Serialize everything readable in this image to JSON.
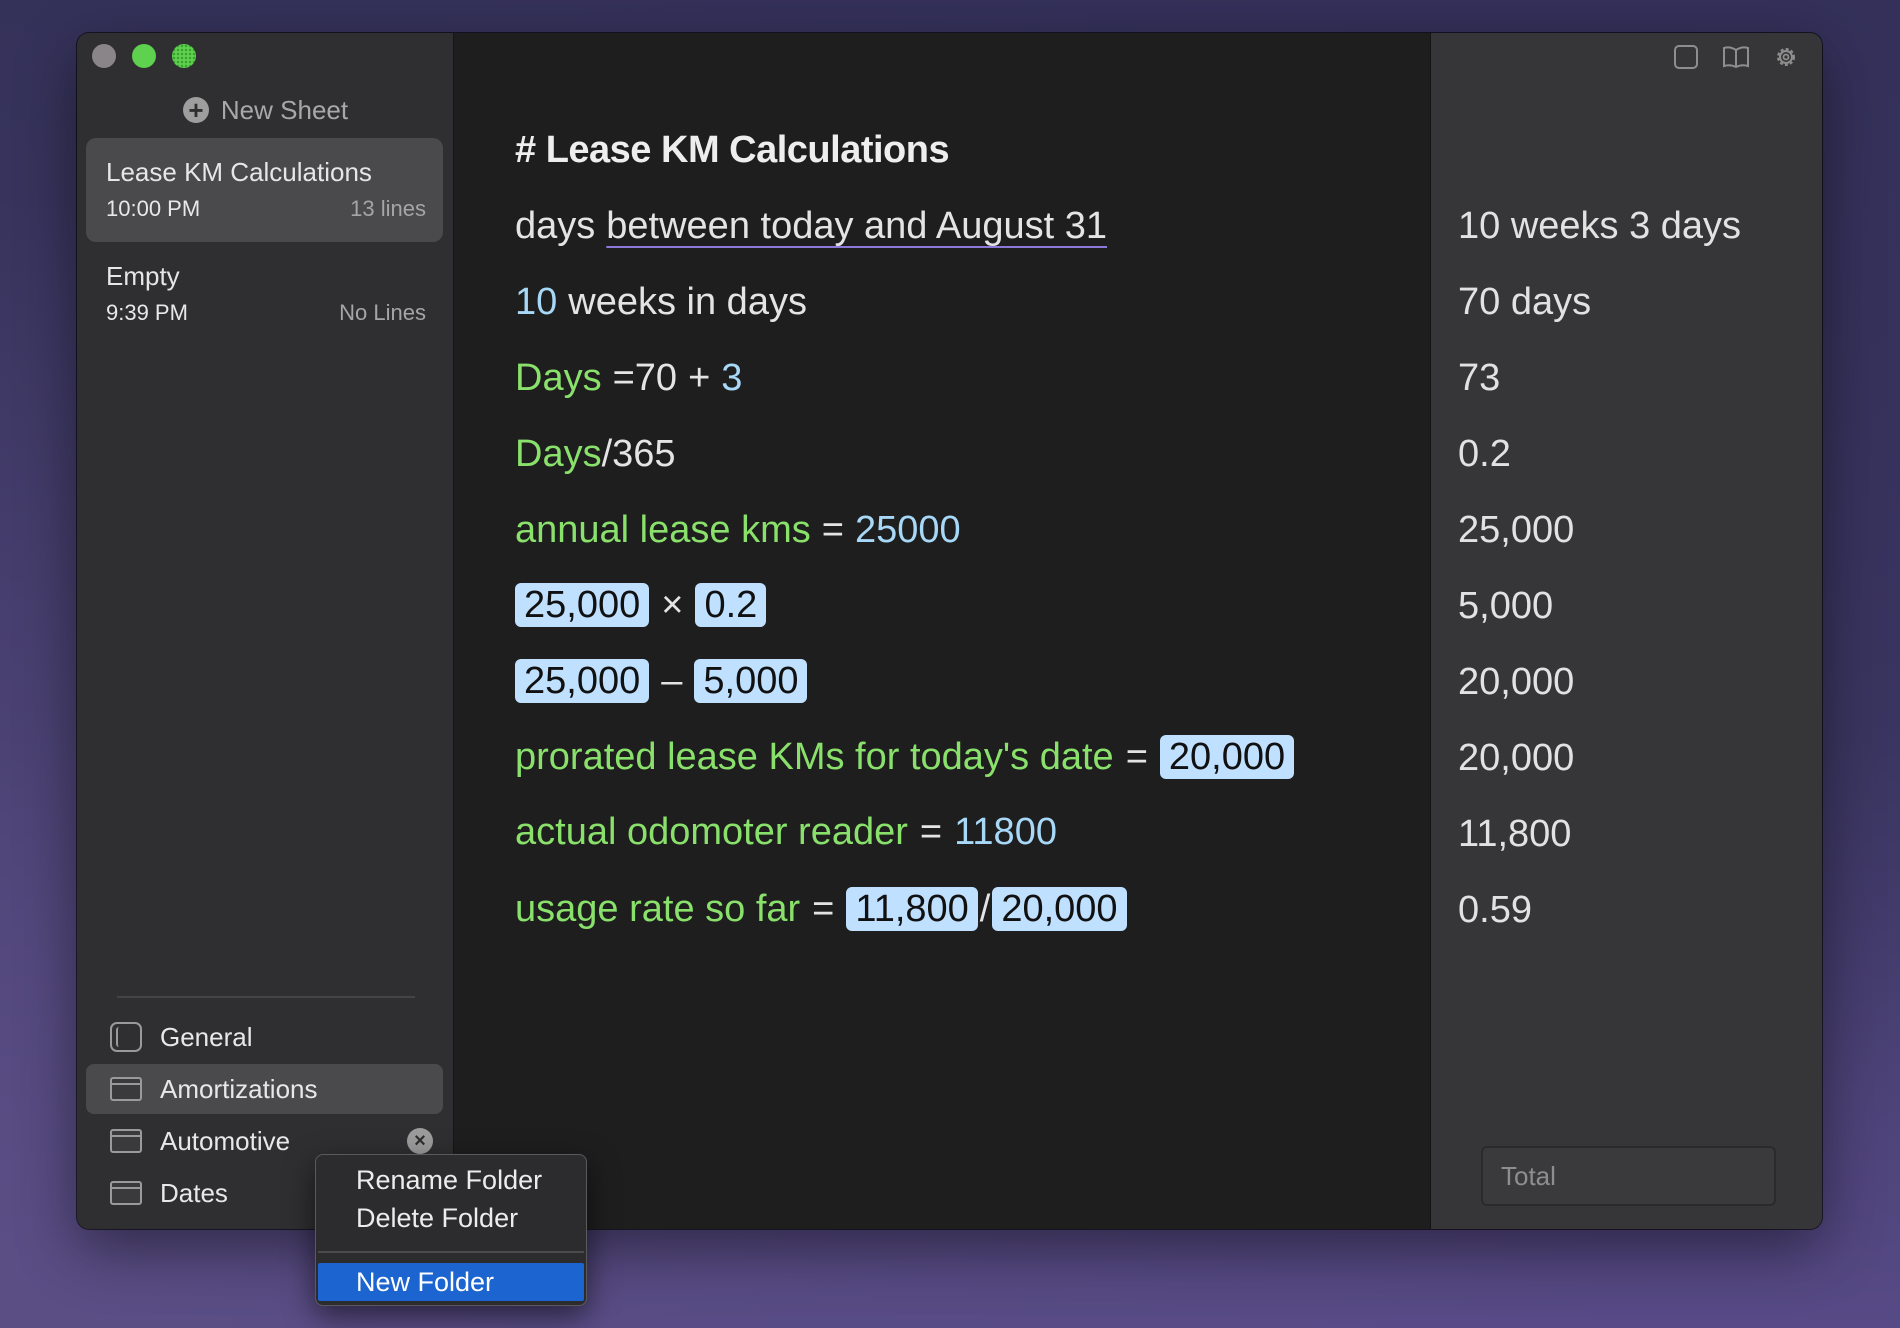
{
  "sidebar": {
    "new_sheet_label": "New Sheet",
    "sheets": [
      {
        "title": "Lease KM Calculations",
        "time": "10:00 PM",
        "lines": "13 lines"
      },
      {
        "title": "Empty",
        "time": "9:39 PM",
        "lines": "No Lines"
      }
    ],
    "folders": [
      {
        "label": "General",
        "icon": "general-icon"
      },
      {
        "label": "Amortizations",
        "icon": "folder-icon"
      },
      {
        "label": "Automotive",
        "icon": "folder-icon"
      },
      {
        "label": "Dates",
        "icon": "folder-icon"
      }
    ]
  },
  "editor": {
    "heading": "# Lease KM Calculations",
    "l1": {
      "pre": "days",
      "underlined": "between today and August 31"
    },
    "l2": {
      "num": "10",
      "rest": "weeks in days"
    },
    "l3": {
      "var": "Days",
      "eq": "=",
      "a": "70",
      "op": "+",
      "b": "3"
    },
    "l4": {
      "var": "Days",
      "rest": "/365"
    },
    "l5": {
      "var": "annual lease kms",
      "eq": "=",
      "val": "25000"
    },
    "l6": {
      "a": "25,000",
      "op": "×",
      "b": "0.2"
    },
    "l7": {
      "a": "25,000",
      "op": "–",
      "b": "5,000"
    },
    "l8": {
      "var": "prorated lease KMs for today's date",
      "eq": "=",
      "chip": "20,000"
    },
    "l9": {
      "var": "actual odomoter reader",
      "eq": "=",
      "val": "11800"
    },
    "l10": {
      "var": "usage rate so far",
      "eq": "=",
      "a": "11,800",
      "op": "/",
      "b": "20,000"
    }
  },
  "results": {
    "values": [
      "10 weeks 3 days",
      "70 days",
      "73",
      "0.2",
      "25,000",
      "5,000",
      "20,000",
      "20,000",
      "11,800",
      "0.59"
    ],
    "total_placeholder": "Total"
  },
  "context_menu": {
    "items": [
      "Rename Folder",
      "Delete Folder"
    ],
    "highlighted": "New Folder"
  },
  "colors": {
    "variable": "#89e06b",
    "number": "#a8d8f7",
    "chip_bg": "#bfe0ff",
    "selection": "#1c64cf"
  }
}
